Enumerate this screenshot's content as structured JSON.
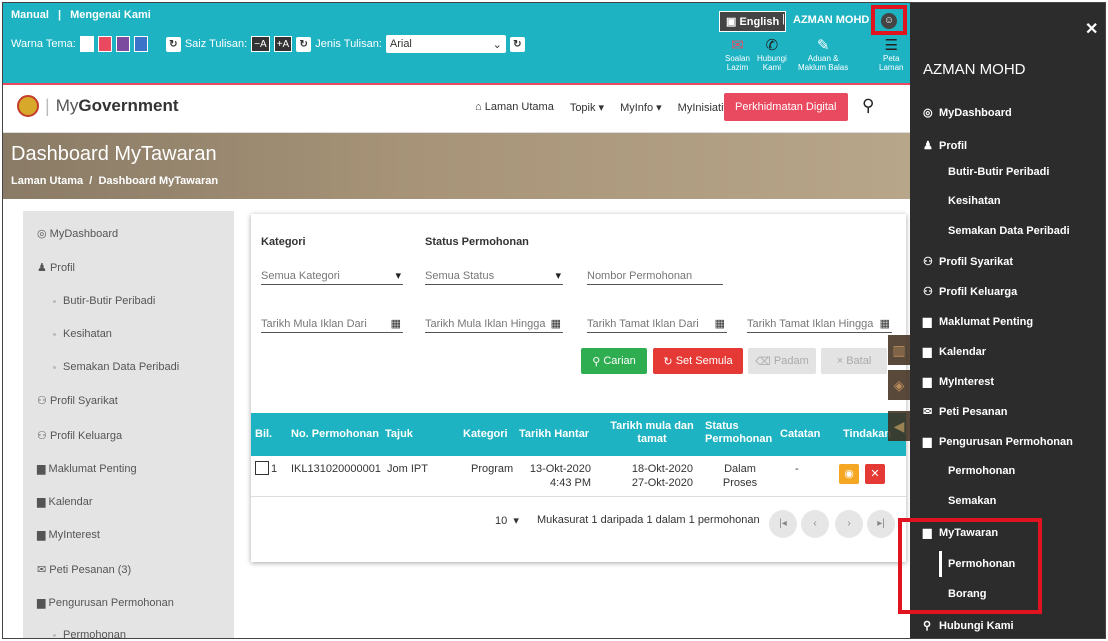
{
  "topbar": {
    "links": [
      "Manual",
      "|",
      "Mengenai Kami"
    ],
    "theme_label": "Warna Tema:",
    "theme_colors": [
      "#1db3c2",
      "#e94a60",
      "#7a4b9e",
      "#3b73c9"
    ],
    "fontsize_label": "Saiz Tulisan:",
    "fontsize_minus": "−A",
    "fontsize_plus": "+A",
    "fonttype_label": "Jenis Tulisan:",
    "fonttype_value": "Arial",
    "lang_button": "English",
    "user_name": "AZMAN MOHD",
    "quick_links": [
      {
        "icon": "faq-icon",
        "label1": "Soalan",
        "label2": "Lazim"
      },
      {
        "icon": "phone-icon",
        "label1": "Hubungi",
        "label2": "Kami"
      },
      {
        "icon": "feedback-icon",
        "label1": "Aduan &",
        "label2": "Maklum Balas"
      },
      {
        "icon": "sitemap-icon",
        "label1": "Peta",
        "label2": "Laman"
      }
    ]
  },
  "navbar": {
    "logo_text_prefix": "My",
    "logo_text_main": "Government",
    "items": [
      "Laman Utama",
      "Topik ▾",
      "MyInfo ▾",
      "MyInisiatif ▾"
    ],
    "digital_button": "Perkhidmatan Digital"
  },
  "banner": {
    "title": "Dashboard MyTawaran",
    "crumb_home": "Laman Utama",
    "crumb_sep": "/",
    "crumb_current": "Dashboard MyTawaran"
  },
  "left_sidebar": {
    "items": [
      "MyDashboard",
      "Profil",
      "Butir-Butir Peribadi",
      "Kesihatan",
      "Semakan Data Peribadi",
      "Profil Syarikat",
      "Profil Keluarga",
      "Maklumat Penting",
      "Kalendar",
      "MyInterest",
      "Peti Pesanan (3)",
      "Pengurusan Permohonan",
      "Permohonan"
    ]
  },
  "filters": {
    "kategori_label": "Kategori",
    "status_label": "Status Permohonan",
    "kategori_value": "Semua Kategori",
    "status_value": "Semua Status",
    "nombor_placeholder": "Nombor Permohonan",
    "date1": "Tarikh Mula Iklan Dari",
    "date2": "Tarikh Mula Iklan Hingga",
    "date3": "Tarikh Tamat Iklan Dari",
    "date4": "Tarikh Tamat Iklan Hingga"
  },
  "buttons": {
    "carian": "Carian",
    "set_semula": "Set Semula",
    "padam": "Padam",
    "batal": "Batal"
  },
  "table": {
    "headers": [
      "Bil.",
      "No. Permohonan",
      "Tajuk",
      "Kategori",
      "Tarikh Hantar",
      "Tarikh mula dan tamat",
      "Status Permohonan",
      "Catatan",
      "Tindakan"
    ],
    "row": {
      "bil": "1",
      "no": "IKL131020000001",
      "tajuk": "Jom IPT",
      "kategori": "Program",
      "hantar_date": "13-Okt-2020",
      "hantar_time": "4:43 PM",
      "mula": "18-Okt-2020",
      "tamat": "27-Okt-2020",
      "status1": "Dalam",
      "status2": "Proses",
      "catatan": "-"
    }
  },
  "pagination": {
    "per_page": "10",
    "summary": "Mukasurat 1 daripada 1 dalam 1 permohonan"
  },
  "right_sidebar": {
    "user_name": "AZMAN MOHD",
    "items": [
      {
        "label": "MyDashboard",
        "icon": "dashboard-icon"
      },
      {
        "label": "Profil",
        "icon": "user-icon"
      },
      {
        "label": "Butir-Butir Peribadi",
        "icon": ""
      },
      {
        "label": "Kesihatan",
        "icon": ""
      },
      {
        "label": "Semakan Data Peribadi",
        "icon": ""
      },
      {
        "label": "Profil Syarikat",
        "icon": "users-icon"
      },
      {
        "label": "Profil Keluarga",
        "icon": "users-icon"
      },
      {
        "label": "Maklumat Penting",
        "icon": "file-icon"
      },
      {
        "label": "Kalendar",
        "icon": "file-icon"
      },
      {
        "label": "MyInterest",
        "icon": "file-icon"
      },
      {
        "label": "Peti Pesanan",
        "icon": "envelope-icon"
      },
      {
        "label": "Pengurusan Permohonan",
        "icon": "file-icon"
      },
      {
        "label": "Permohonan",
        "icon": ""
      },
      {
        "label": "Semakan",
        "icon": ""
      },
      {
        "label": "MyTawaran",
        "icon": "file-icon"
      },
      {
        "label": "Permohonan",
        "icon": ""
      },
      {
        "label": "Borang",
        "icon": ""
      },
      {
        "label": "Hubungi Kami",
        "icon": "map-marker-icon"
      }
    ]
  }
}
